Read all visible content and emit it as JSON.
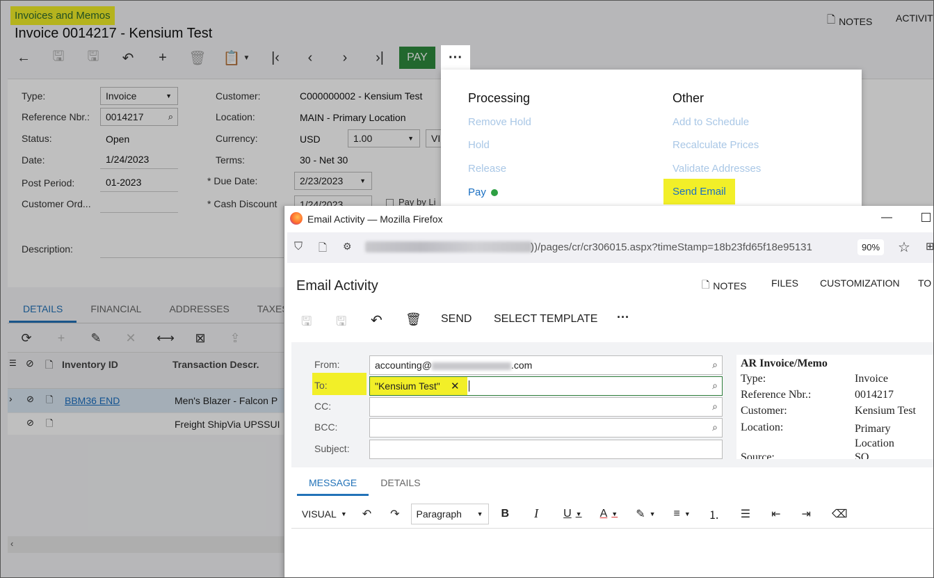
{
  "app": {
    "breadcrumb": "Invoices and Memos",
    "title": "Invoice 0014217 - Kensium Test",
    "top_actions": {
      "notes": "NOTES",
      "activities": "ACTIVITI"
    },
    "toolbar": {
      "pay": "PAY",
      "more": "···"
    }
  },
  "form": {
    "type": {
      "label": "Type:",
      "value": "Invoice"
    },
    "ref": {
      "label": "Reference Nbr.:",
      "value": "0014217"
    },
    "status": {
      "label": "Status:",
      "value": "Open"
    },
    "date": {
      "label": "Date:",
      "value": "1/24/2023"
    },
    "post_period": {
      "label": "Post Period:",
      "value": "01-2023"
    },
    "customer_ord": {
      "label": "Customer Ord...",
      "value": ""
    },
    "description": {
      "label": "Description:"
    },
    "customer": {
      "label": "Customer:",
      "value": "C000000002 - Kensium Test"
    },
    "location": {
      "label": "Location:",
      "value": "MAIN - Primary Location"
    },
    "currency": {
      "label": "Currency:",
      "value": "USD",
      "rate": "1.00",
      "extra": "VI"
    },
    "terms": {
      "label": "Terms:",
      "value": "30 - Net 30"
    },
    "due_date": {
      "label": "Due Date:",
      "value": "2/23/2023",
      "required": "*"
    },
    "cash_discount": {
      "label": "Cash Discount",
      "value": "1/24/2023",
      "required": "*"
    },
    "pay_by": "Pay by Li"
  },
  "tabs": [
    "DETAILS",
    "FINANCIAL",
    "ADDRESSES",
    "TAXES"
  ],
  "grid": {
    "headers": {
      "inventory": "Inventory ID",
      "descr": "Transaction Descr."
    },
    "rows": [
      {
        "inventory": "BBM36 END",
        "descr": "Men's Blazer - Falcon P"
      },
      {
        "inventory": "",
        "descr": "Freight ShipVia UPSSUI"
      }
    ]
  },
  "dropdown": {
    "processing": {
      "title": "Processing",
      "items": [
        "Remove Hold",
        "Hold",
        "Release",
        "Pay"
      ]
    },
    "other": {
      "title": "Other",
      "items": [
        "Add to Schedule",
        "Recalculate Prices",
        "Validate Addresses",
        "Send Email"
      ]
    }
  },
  "firefox": {
    "window_title": "Email Activity — Mozilla Firefox",
    "url": "))/pages/cr/cr306015.aspx?timeStamp=18b23fd65f18e95131",
    "zoom": "90%"
  },
  "email": {
    "title": "Email Activity",
    "top_actions": [
      "NOTES",
      "FILES",
      "CUSTOMIZATION",
      "TO"
    ],
    "toolbar": {
      "send": "SEND",
      "select_template": "SELECT TEMPLATE",
      "more": "···"
    },
    "from": {
      "label": "From:",
      "value_prefix": "accounting@",
      "value_suffix": ".com"
    },
    "to": {
      "label": "To:",
      "chip": "\"Kensium Test\""
    },
    "cc": {
      "label": "CC:"
    },
    "bcc": {
      "label": "BCC:"
    },
    "subject": {
      "label": "Subject:"
    },
    "tabs": [
      "MESSAGE",
      "DETAILS"
    ],
    "editor": {
      "mode": "VISUAL",
      "block": "Paragraph"
    },
    "ar_panel": {
      "title": "AR Invoice/Memo",
      "rows": [
        {
          "k": "Type:",
          "v": "Invoice"
        },
        {
          "k": "Reference Nbr.:",
          "v": "0014217"
        },
        {
          "k": "Customer:",
          "v": "Kensium Test"
        },
        {
          "k": "Location:",
          "v": "Primary Location"
        },
        {
          "k": "Source:",
          "v": "SO"
        }
      ]
    }
  },
  "colors": {
    "highlight": "#f2ef28",
    "accent": "#2272b8",
    "pay_green": "#2e8b3e",
    "status_dot": "#2ea043"
  }
}
